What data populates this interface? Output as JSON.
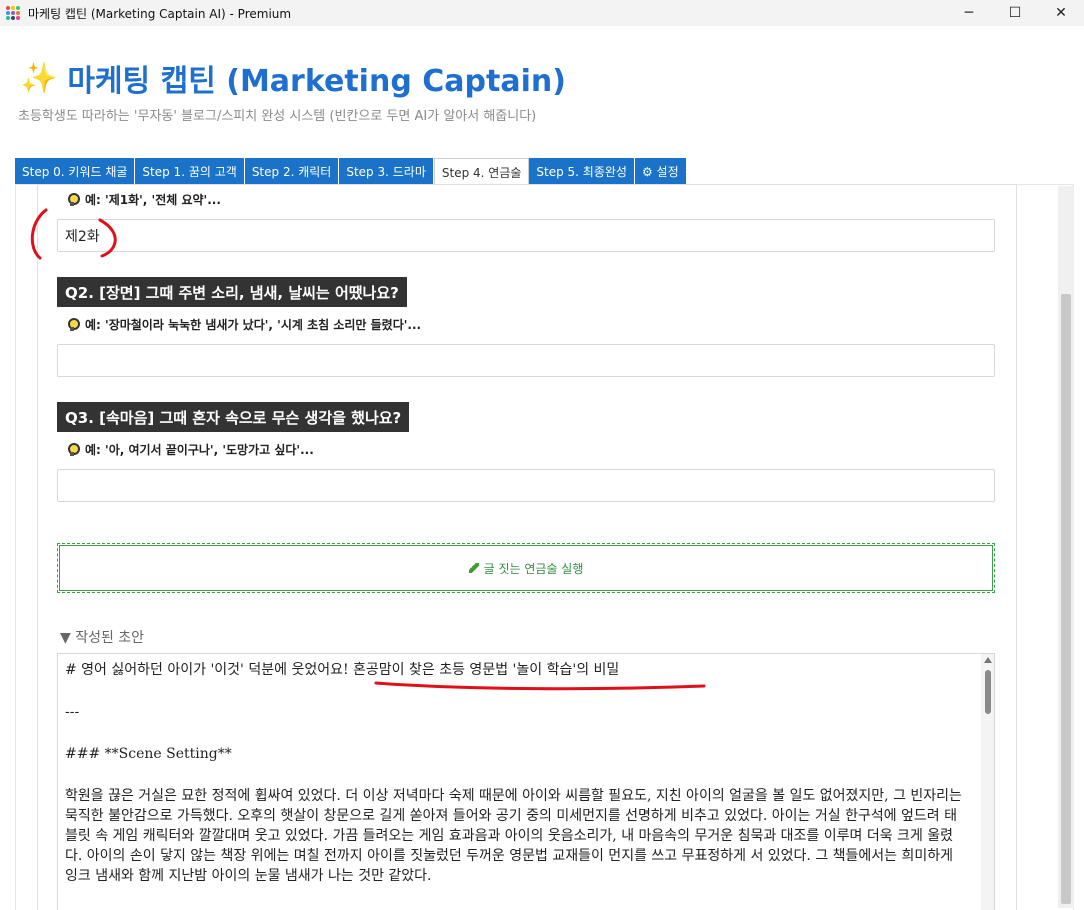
{
  "window": {
    "title": "마케팅 캡틴 (Marketing Captain AI) - Premium",
    "minimize_icon": "─",
    "maximize_icon": "☐",
    "close_icon": "✕"
  },
  "header": {
    "sparkle_icon": "✨",
    "title": "마케팅 캡틴 (Marketing Captain)",
    "subtitle": "초등학생도 따라하는 '무자동' 블로그/스피치 완성 시스템 (빈칸으로 두면 AI가 알아서 해줍니다)"
  },
  "tabs": [
    {
      "label": "Step 0. 키워드 채굴",
      "active": false
    },
    {
      "label": "Step 1. 꿈의 고객",
      "active": false
    },
    {
      "label": "Step 2. 캐릭터",
      "active": false
    },
    {
      "label": "Step 3. 드라마",
      "active": false
    },
    {
      "label": "Step 4. 연금술",
      "active": true
    },
    {
      "label": "Step 5. 최종완성",
      "active": false
    },
    {
      "label": "⚙ 설정",
      "active": false
    }
  ],
  "form": {
    "q1_hint": "예: '제1화', '전체 요약'...",
    "q1_value": "제2화",
    "q2_label": "Q2. [장면] 그때 주변 소리, 냄새, 날씨는 어땠나요?",
    "q2_hint": "예: '장마철이라 눅눅한 냄새가 났다', '시계 초침 소리만 들렸다'...",
    "q2_value": "",
    "q3_label": "Q3. [속마음] 그때 혼자 속으로 무슨 생각을 했나요?",
    "q3_hint": "예: '아, 여기서 끝이구나', '도망가고 싶다'...",
    "q3_value": "",
    "run_button": "글 짓는 연금술 실행"
  },
  "draft": {
    "section_title": "▼ 작성된 초안",
    "lines": [
      "# 영어 싫어하던 아이가 '이것' 덕분에 웃었어요! 혼공맘이 찾은 초등 영문법 '놀이 학습'의 비밀",
      "---",
      "### **Scene Setting**",
      "학원을 끊은 거실은 묘한 정적에 휩싸여 있었다. 더 이상 저녁마다 숙제 때문에 아이와 씨름할 필요도, 지친 아이의 얼굴을 볼 일도 없어졌지만, 그 빈자리는 묵직한 불안감으로 가득했다. 오후의 햇살이 창문으로 길게 쏟아져 들어와 공기 중의 미세먼지를 선명하게 비추고 있었다. 아이는 거실 한구석에 엎드려 태블릿 속 게임 캐릭터와 깔깔대며 웃고 있었다. 가끔 들려오는 게임 효과음과 아이의 웃음소리가, 내 마음속의 무거운 침묵과 대조를 이루며 더욱 크게 울렸다. 아이의 손이 닿지 않는 책장 위에는 며칠 전까지 아이를 짓눌렀던 두꺼운 영문법 교재들이 먼지를 쓰고 무표정하게 서 있었다. 그 책들에서는 희미하게 잉크 냄새와 함께 지난밤 아이의 눈물 냄새가 나는 것만 같았다."
    ]
  },
  "colors": {
    "accent": "#1f6fd1",
    "tab_bg": "#1a73c9",
    "label_bg": "#333333",
    "run_green": "#3aa14a",
    "annotation_red": "#e0101a"
  }
}
